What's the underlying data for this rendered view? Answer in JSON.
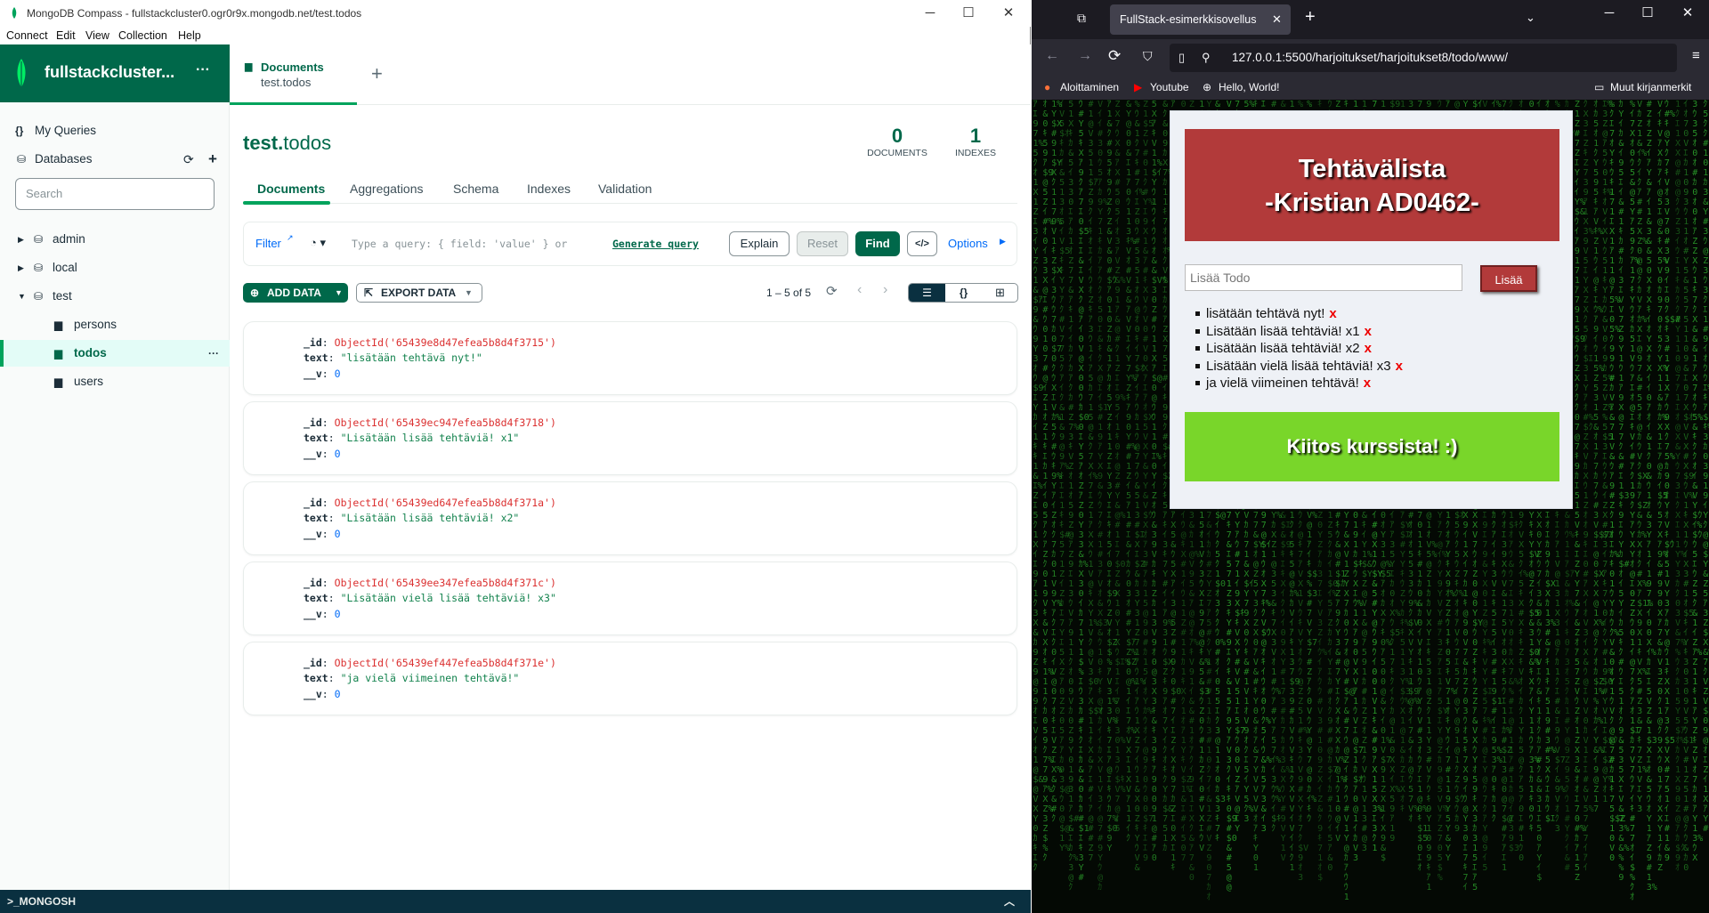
{
  "compass": {
    "window_title": "MongoDB Compass - fullstackcluster0.ogr0r9x.mongodb.net/test.todos",
    "menu": [
      "Connect",
      "Edit",
      "View",
      "Collection",
      "Help"
    ],
    "cluster_name": "fullstackcluster...",
    "sidebar": {
      "my_queries": "My Queries",
      "databases": "Databases",
      "search_placeholder": "Search",
      "dbs": [
        {
          "name": "admin",
          "expanded": false
        },
        {
          "name": "local",
          "expanded": false
        },
        {
          "name": "test",
          "expanded": true
        }
      ],
      "collections": [
        "persons",
        "todos",
        "users"
      ],
      "active_collection": "todos"
    },
    "tab": {
      "title": "Documents",
      "subtitle": "test.todos"
    },
    "namespace": {
      "db": "test.",
      "collection": "todos"
    },
    "stats": {
      "documents_value": "0",
      "documents_label": "DOCUMENTS",
      "indexes_value": "1",
      "indexes_label": "INDEXES"
    },
    "subtabs": [
      "Documents",
      "Aggregations",
      "Schema",
      "Indexes",
      "Validation"
    ],
    "query_bar": {
      "filter_label": "Filter",
      "placeholder": "Type a query: { field: 'value' } or",
      "generate_query": "Generate query",
      "explain": "Explain",
      "reset": "Reset",
      "find": "Find",
      "options": "Options"
    },
    "toolbar": {
      "add_data": "ADD DATA",
      "export_data": "EXPORT DATA",
      "pagination": "1 – 5 of 5"
    },
    "documents": [
      {
        "id": "ObjectId('65439e8d47efea5b8d4f3715')",
        "text": "\"lisätään tehtävä nyt!\"",
        "v": "0"
      },
      {
        "id": "ObjectId('65439ec947efea5b8d4f3718')",
        "text": "\"Lisätään lisää tehtäviä! x1\"",
        "v": "0"
      },
      {
        "id": "ObjectId('65439ed647efea5b8d4f371a')",
        "text": "\"Lisätään lisää tehtäviä! x2\"",
        "v": "0"
      },
      {
        "id": "ObjectId('65439ee347efea5b8d4f371c')",
        "text": "\"Lisätään vielä lisää tehtäviä! x3\"",
        "v": "0"
      },
      {
        "id": "ObjectId('65439ef447efea5b8d4f371e')",
        "text": "\"ja vielä viimeinen tehtävä!\"",
        "v": "0"
      }
    ],
    "field_labels": {
      "id": "_id",
      "text": "text",
      "v": "__v"
    },
    "mongosh": ">_MONGOSH"
  },
  "firefox": {
    "tab_title": "FullStack-esimerkkisovellus",
    "url": "127.0.0.1:5500/harjoitukset/harjoitukset8/todo/www/",
    "bookmarks": [
      "Aloittaminen",
      "Youtube",
      "Hello, World!"
    ],
    "other_bookmarks": "Muut kirjanmerkit"
  },
  "todo_app": {
    "title_line1": "Tehtävälista",
    "title_line2": "-Kristian AD0462-",
    "input_placeholder": "Lisää Todo",
    "add_button": "Lisää",
    "delete_mark": "x",
    "items": [
      "lisätään tehtävä nyt!",
      "Lisätään lisää tehtäviä! x1",
      "Lisätään lisää tehtäviä! x2",
      "Lisätään vielä lisää tehtäviä! x3",
      "ja vielä viimeinen tehtävä!"
    ],
    "footer": "Kiitos kurssista! :)"
  },
  "colors": {
    "compass_green": "#00684a",
    "compass_accent": "#00a35c",
    "todo_header_red": "#b23a3a",
    "todo_footer_green": "#79d62a",
    "matrix_green": "#2fae2f"
  }
}
